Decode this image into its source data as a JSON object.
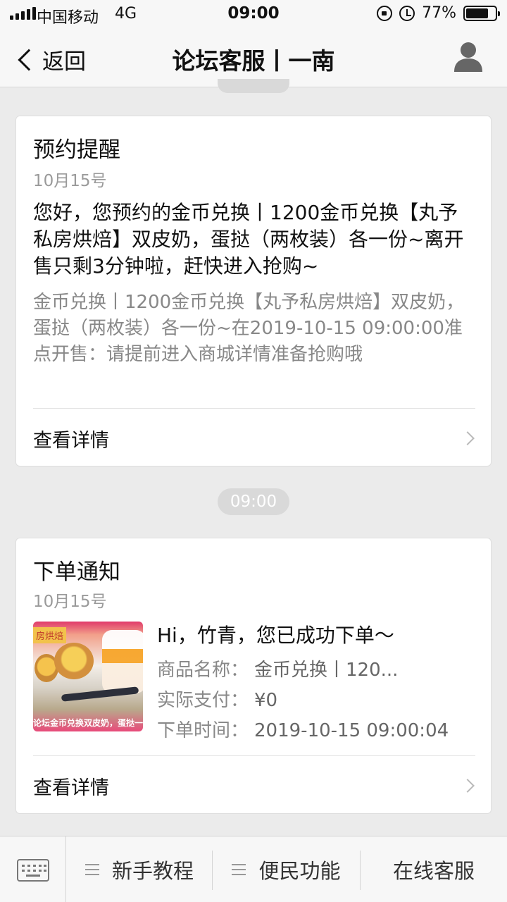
{
  "status_bar": {
    "carrier": "中国移动",
    "network": "4G",
    "time": "09:00",
    "battery": "77%",
    "battery_level": 0.77
  },
  "nav": {
    "back_label": "返回",
    "title": "论坛客服丨一南"
  },
  "feed": {
    "time_divider": "09:00",
    "reminder_card": {
      "title": "预约提醒",
      "date": "10月15号",
      "body": "您好，您预约的金币兑换丨1200金币兑换【丸予私房烘焙】双皮奶，蛋挞（两枚装）各一份~离开售只剩3分钟啦，赶快进入抢购~",
      "detail": "金币兑换丨1200金币兑换【丸予私房烘焙】双皮奶，蛋挞（两枚装）各一份~在2019-10-15 09:00:00准点开售：请提前进入商城详情准备抢购哦",
      "link_label": "查看详情"
    },
    "order_card": {
      "title": "下单通知",
      "date": "10月15号",
      "thumb_tag": "房烘焙",
      "thumb_caption": "论坛金币兑换双皮奶，蛋挞一",
      "greeting": "Hi，竹青，您已成功下单～",
      "product_label": "商品名称：",
      "product_value": "金币兑换丨120...",
      "payment_label": "实际支付：",
      "payment_value": "¥0",
      "order_time_label": "下单时间：",
      "order_time_value": "2019-10-15 09:00:04",
      "link_label": "查看详情"
    }
  },
  "bottom_menu": {
    "items": [
      {
        "label": "新手教程"
      },
      {
        "label": "便民功能"
      },
      {
        "label": "在线客服"
      }
    ]
  }
}
